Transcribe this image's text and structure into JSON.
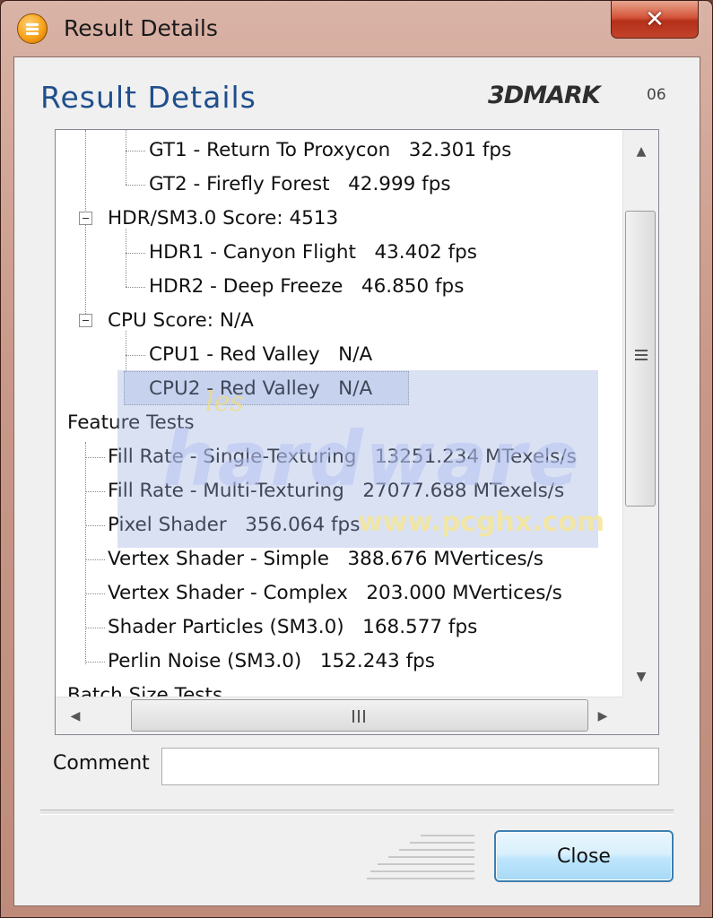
{
  "window": {
    "title": "Result Details"
  },
  "header": {
    "title": "Result Details",
    "logo_text": "3DMARK",
    "logo_sup": "06"
  },
  "tree": {
    "rows": [
      {
        "label": "GT1 - Return To Proxycon",
        "value": "32.301 fps"
      },
      {
        "label": "GT2 - Firefly Forest",
        "value": "42.999 fps"
      },
      {
        "label": "HDR/SM3.0 Score:",
        "value": "4513"
      },
      {
        "label": "HDR1 - Canyon Flight",
        "value": "43.402 fps"
      },
      {
        "label": "HDR2 - Deep Freeze",
        "value": "46.850 fps"
      },
      {
        "label": "CPU Score:",
        "value": "N/A"
      },
      {
        "label": "CPU1 - Red Valley",
        "value": "N/A"
      },
      {
        "label": "CPU2 - Red Valley",
        "value": "N/A"
      },
      {
        "label": "Feature Tests",
        "value": ""
      },
      {
        "label": "Fill Rate - Single-Texturing",
        "value": "13251.234 MTexels/s"
      },
      {
        "label": "Fill Rate - Multi-Texturing",
        "value": "27077.688 MTexels/s"
      },
      {
        "label": "Pixel Shader",
        "value": "356.064 fps"
      },
      {
        "label": "Vertex Shader - Simple",
        "value": "388.676 MVertices/s"
      },
      {
        "label": "Vertex Shader - Complex",
        "value": "203.000 MVertices/s"
      },
      {
        "label": "Shader Particles (SM3.0)",
        "value": "168.577 fps"
      },
      {
        "label": "Perlin Noise (SM3.0)",
        "value": "152.243 fps"
      },
      {
        "label": "Batch Size Tests",
        "value": ""
      }
    ]
  },
  "watermark": {
    "sub": "les",
    "main": "hardware",
    "url": "www.pcghx.com"
  },
  "comment": {
    "label": "Comment",
    "value": ""
  },
  "buttons": {
    "close_label": "Close",
    "title_close_glyph": "✕"
  },
  "scrollbar": {
    "h_grip": "|||"
  },
  "colors": {
    "heading": "#1f4f8c",
    "button_border": "#3c7fb1",
    "title_close": "#c2432a"
  }
}
